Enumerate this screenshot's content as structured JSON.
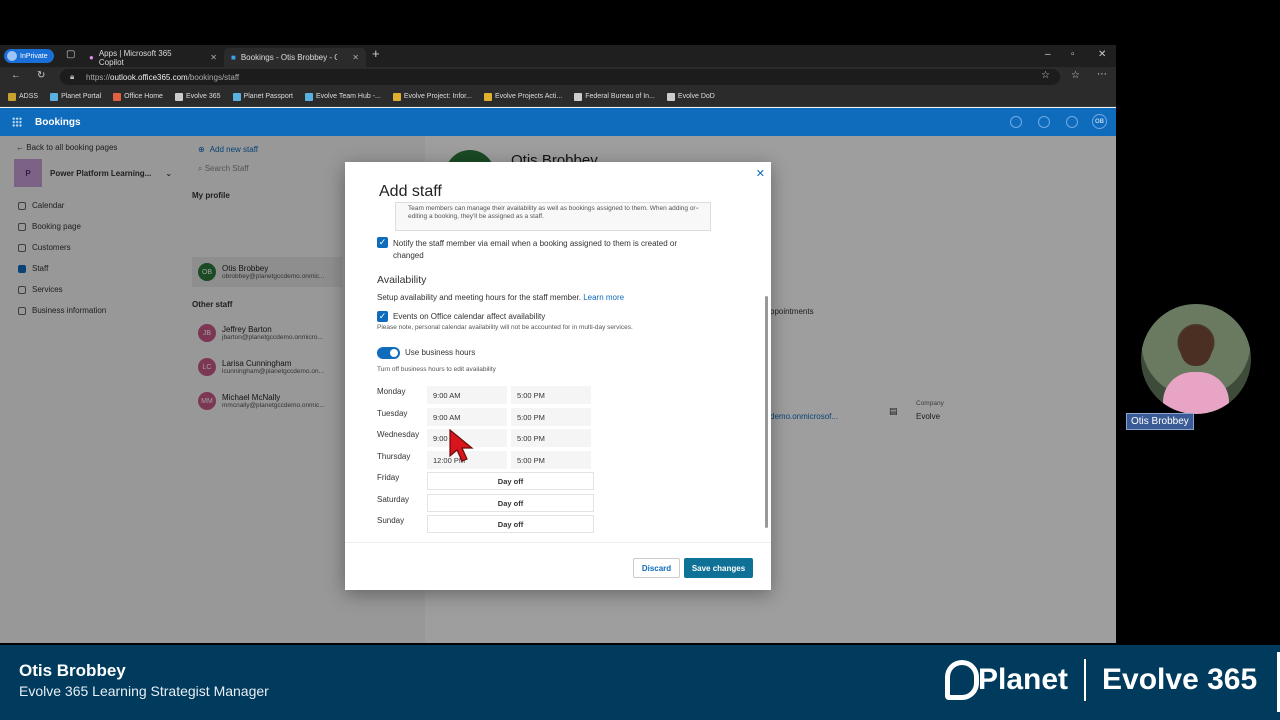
{
  "browser": {
    "inprivate_label": "InPrivate",
    "tabs": [
      {
        "label": "Apps | Microsoft 365 Copilot"
      },
      {
        "label": "Bookings - Otis Brobbey - Outlo"
      }
    ],
    "url_prefix": "https://",
    "url_host": "outlook.office365.com",
    "url_path": "/bookings/staff",
    "bookmarks": [
      "ADSS",
      "Planet Portal",
      "Office Home",
      "Evolve 365",
      "Planet Passport",
      "Evolve Team Hub -...",
      "Evolve Project: Infor...",
      "Evolve Projects Acti...",
      "Federal Bureau of In...",
      "Evolve DoD"
    ]
  },
  "app": {
    "title": "Bookings",
    "accent": "#0f6cbd",
    "user_initials": "OB"
  },
  "leftnav": {
    "back": "Back to all booking pages",
    "page_initial": "P",
    "page_name": "Power Platform Learning...",
    "items": [
      "Calendar",
      "Booking page",
      "Customers",
      "Staff",
      "Services",
      "Business information"
    ]
  },
  "staff": {
    "add": "Add new staff",
    "search_placeholder": "Search Staff",
    "my_profile": "My profile",
    "other_staff": "Other staff",
    "me": {
      "initials": "OB",
      "name": "Otis Brobbey",
      "email": "obrobbey@planetgccdemo.onmic..."
    },
    "others": [
      {
        "initials": "JB",
        "name": "Jeffrey Barton",
        "email": "jbarton@planetgccdemo.onmicro..."
      },
      {
        "initials": "LC",
        "name": "Larisa Cunningham",
        "email": "lcunningham@planetgccdemo.on..."
      },
      {
        "initials": "MM",
        "name": "Michael McNally",
        "email": "mmcnally@planetgccdemo.onmic..."
      }
    ]
  },
  "detail": {
    "name": "Otis Brobbey",
    "tab": "ppointments",
    "email_partial": "demo.onmicrosof...",
    "company_label": "Company",
    "company_value": "Evolve"
  },
  "modal": {
    "title": "Add staff",
    "note": "Team members can manage their availability as well as bookings assigned to them. When adding or editing a booking, they'll be assigned as a staff.",
    "notify_label": "Notify the staff member via email when a booking assigned to them is created or changed",
    "availability_heading": "Availability",
    "availability_desc": "Setup availability and meeting hours for the staff member.",
    "learn_more": "Learn more",
    "events_label": "Events on Office calendar affect availability",
    "events_note": "Please note, personal calendar availability will not be accounted for in multi-day services.",
    "business_hours_label": "Use business hours",
    "business_hours_note": "Turn off business hours to edit availability",
    "days": [
      {
        "day": "Monday",
        "start": "9:00 AM",
        "end": "5:00 PM"
      },
      {
        "day": "Tuesday",
        "start": "9:00 AM",
        "end": "5:00 PM"
      },
      {
        "day": "Wednesday",
        "start": "9:00",
        "end": "5:00 PM"
      },
      {
        "day": "Thursday",
        "start": "12:00 PM",
        "end": "5:00 PM"
      },
      {
        "day": "Friday",
        "off": "Day off"
      },
      {
        "day": "Saturday",
        "off": "Day off"
      },
      {
        "day": "Sunday",
        "off": "Day off"
      }
    ],
    "discard": "Discard",
    "save": "Save changes"
  },
  "presenter": {
    "webcam_name": "Otis Brobbey",
    "name": "Otis Brobbey",
    "role": "Evolve 365 Learning Strategist Manager",
    "brand_left": "Planet",
    "brand_right": "Evolve 365"
  }
}
